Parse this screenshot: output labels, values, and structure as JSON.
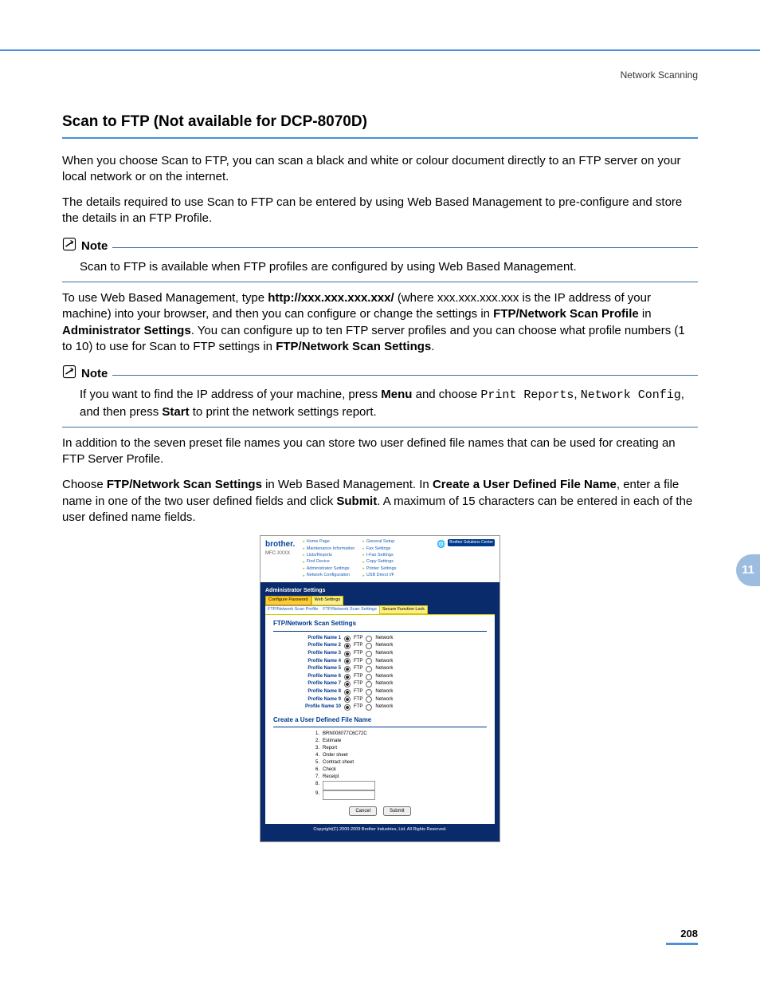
{
  "header": {
    "section": "Network Scanning"
  },
  "title": "Scan to FTP (Not available for DCP-8070D)",
  "para1": "When you choose Scan to FTP, you can scan a black and white or colour document directly to an FTP server on your local network or on the internet.",
  "para2": "The details required to use Scan to FTP can be entered by using Web Based Management to pre-configure and store the details in an FTP Profile.",
  "note1": {
    "label": "Note",
    "text": "Scan to FTP is available when FTP profiles are configured by using Web Based Management."
  },
  "para3": {
    "pre": "To use Web Based Management, type ",
    "url": "http://xxx.xxx.xxx.xxx/",
    "mid": " (where xxx.xxx.xxx.xxx is the IP address of your machine) into your browser, and then you can configure or change the settings in ",
    "b1": "FTP/Network Scan Profile",
    "in": " in ",
    "b2": "Administrator Settings",
    "post": ". You can configure up to ten FTP server profiles and you can choose what profile numbers (1 to 10) to use for Scan to FTP settings in ",
    "b3": "FTP/Network Scan Settings",
    "end": "."
  },
  "note2": {
    "label": "Note",
    "pre": "If you want to find the IP address of your machine, press ",
    "menu": "Menu",
    "mid1": " and choose ",
    "c1": "Print Reports",
    "sep": ", ",
    "c2": "Network Config",
    "mid2": ", and then press ",
    "start": "Start",
    "post": " to print the network settings report."
  },
  "para4": "In addition to the seven preset file names you can store two user defined file names that can be used for creating an FTP Server Profile.",
  "para5": {
    "pre": "Choose ",
    "b1": "FTP/Network Scan Settings",
    "mid1": " in Web Based Management. In ",
    "b2": "Create a User Defined File Name",
    "mid2": ", enter a file name in one of the two user defined fields and click ",
    "b3": "Submit",
    "post": ". A maximum of 15 characters can be entered in each of the user defined name fields."
  },
  "embed": {
    "logo": "brother.",
    "model": "MFC-XXXX",
    "navLeft": [
      "Home Page",
      "Maintenance Information",
      "Lists/Reports",
      "Find Device",
      "Administrator Settings",
      "Network Configuration"
    ],
    "navRight": [
      "General Setup",
      "Fax Settings",
      "I-Fax Settings",
      "Copy Settings",
      "Printer Settings",
      "USB Direct I/F"
    ],
    "bsc": "Brother Solutions Center",
    "adminTitle": "Administrator Settings",
    "tabs": {
      "t1": "Configure Password",
      "t2": "Web Settings",
      "t3a": "FTP/Network Scan Profile",
      "t3b": "FTP/Network Scan Settings",
      "t4": "Secure Function Lock"
    },
    "sectionTitle": "FTP/Network Scan Settings",
    "profiles": [
      "Profile Name 1",
      "Profile Name 2",
      "Profile Name 3",
      "Profile Name 4",
      "Profile Name 5",
      "Profile Name 6",
      "Profile Name 7",
      "Profile Name 8",
      "Profile Name 9",
      "Profile Name 10"
    ],
    "radioFTP": "FTP",
    "radioNet": "Network",
    "udfnTitle": "Create a User Defined File Name",
    "udfn": [
      "BRN008077C6C72C",
      "Estimate",
      "Report",
      "Order sheet",
      "Contract sheet",
      "Check",
      "Receipt"
    ],
    "cancel": "Cancel",
    "submit": "Submit",
    "copyright": "Copyright(C) 2000-2009 Brother Industries, Ltd. All Rights Reserved."
  },
  "chapterTab": "11",
  "pageNumber": "208"
}
